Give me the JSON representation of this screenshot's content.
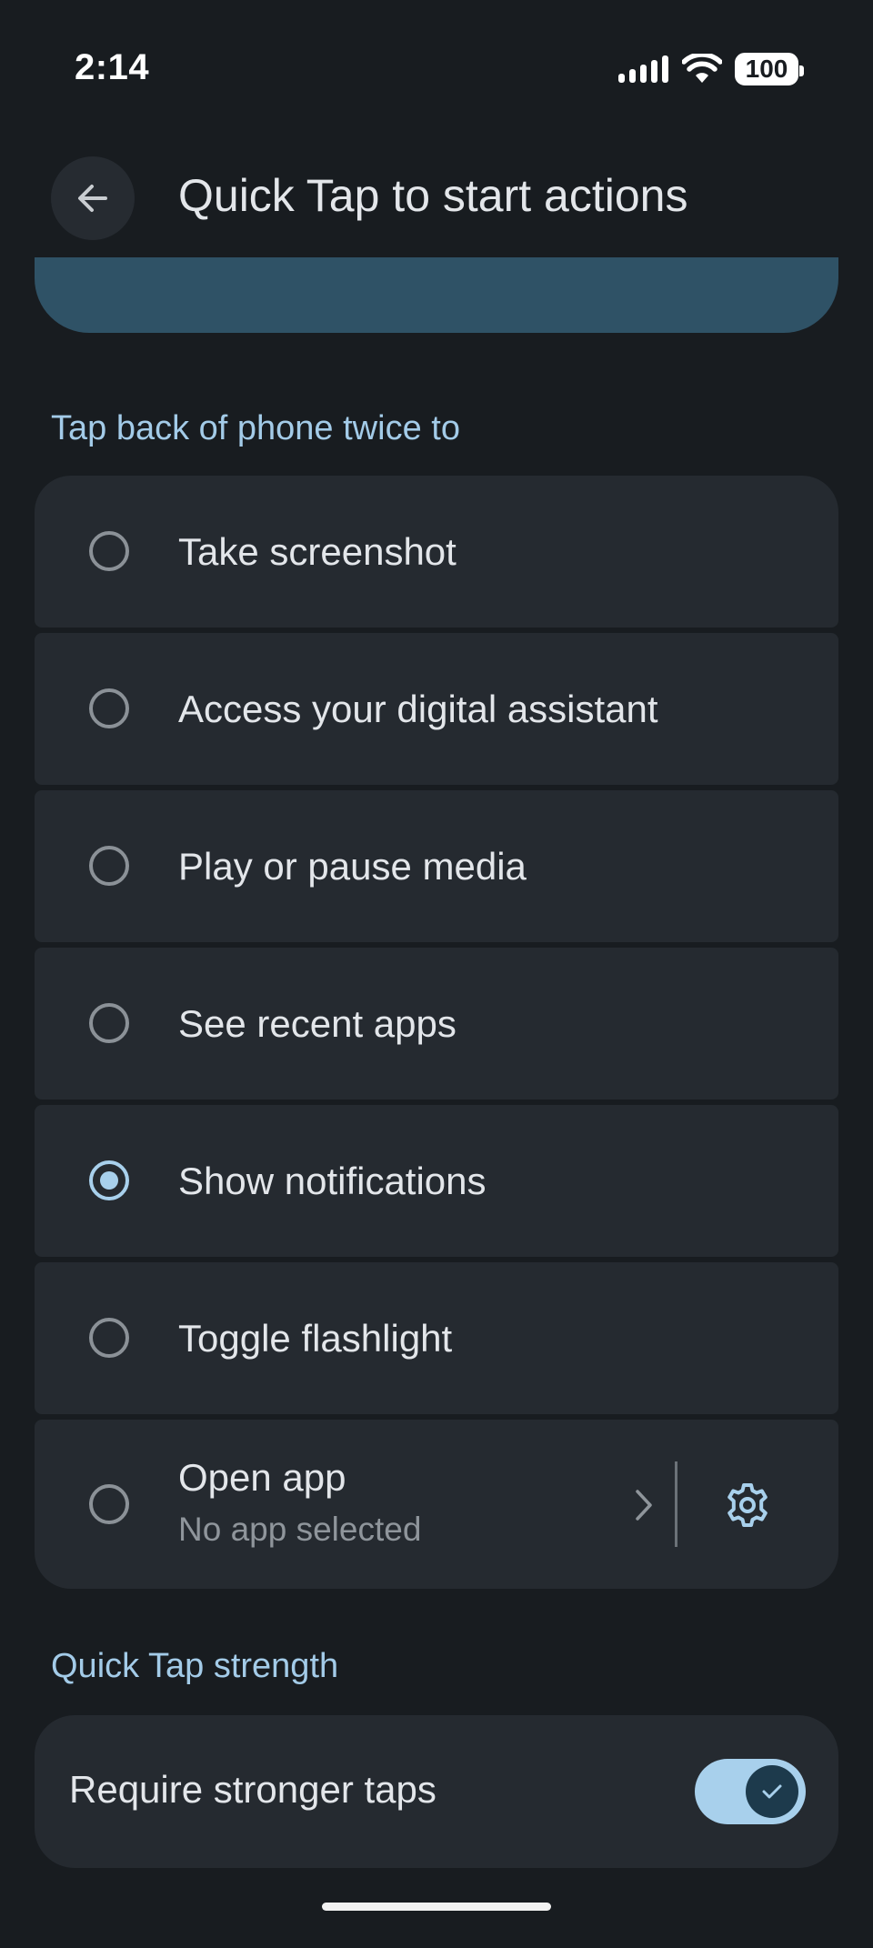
{
  "status_bar": {
    "time": "2:14",
    "battery": "100",
    "icons": [
      "signal-icon",
      "wifi-icon",
      "battery-icon"
    ]
  },
  "header": {
    "title": "Quick Tap to start actions",
    "back_icon": "arrow-back-icon"
  },
  "sections": {
    "actions_header": "Tap back of phone twice to",
    "strength_header": "Quick Tap strength"
  },
  "options": [
    {
      "label": "Take screenshot",
      "selected": false
    },
    {
      "label": "Access your digital assistant",
      "selected": false
    },
    {
      "label": "Play or pause media",
      "selected": false
    },
    {
      "label": "See recent apps",
      "selected": false
    },
    {
      "label": "Show notifications",
      "selected": true
    },
    {
      "label": "Toggle flashlight",
      "selected": false
    },
    {
      "label": "Open app",
      "sublabel": "No app selected",
      "selected": false
    }
  ],
  "strength": {
    "label": "Require stronger taps",
    "enabled": true
  },
  "colors": {
    "background": "#181c20",
    "card": "#252a30",
    "accent": "#a8d0ec",
    "section_header": "#a3cbe8",
    "top_card": "#2f5266"
  }
}
